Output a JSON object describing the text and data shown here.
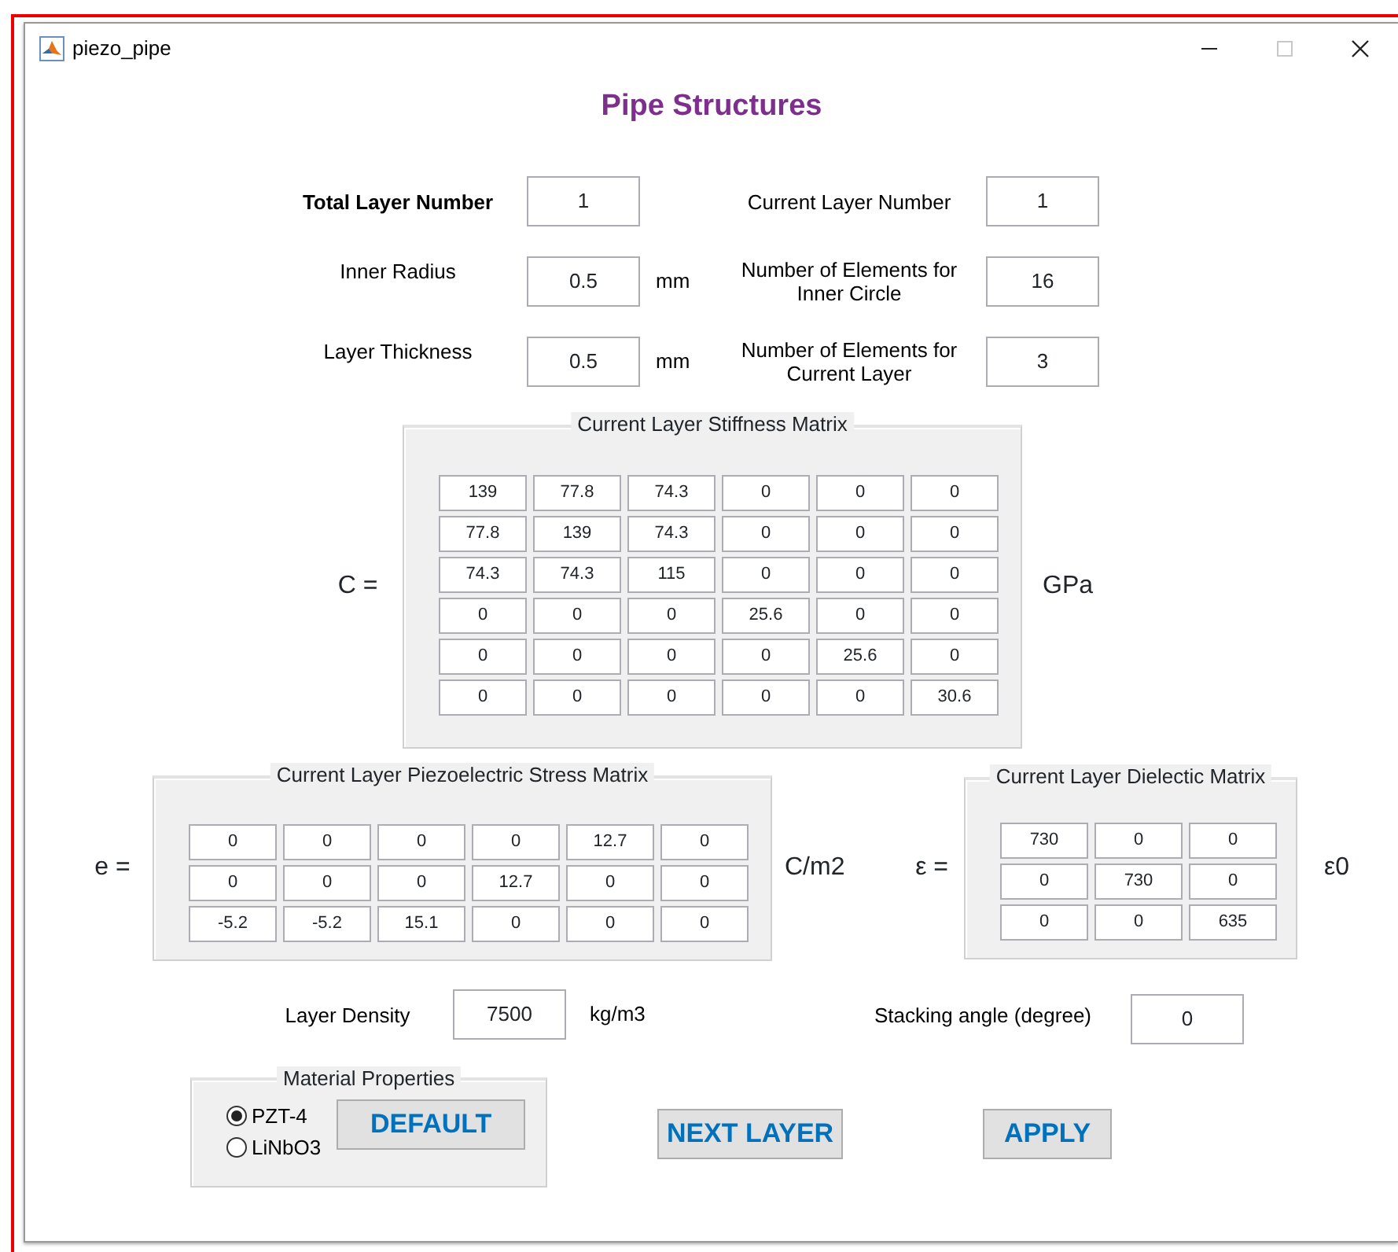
{
  "window": {
    "title": "piezo_pipe",
    "maximize_disabled": true
  },
  "heading": "Pipe Structures",
  "geometry_rows": [
    {
      "left": {
        "label": "Total Layer Number",
        "bold": true,
        "value": "1"
      },
      "right": {
        "label": "Current Layer Number",
        "value": "1"
      }
    },
    {
      "left": {
        "label": "Inner Radius",
        "bold": false,
        "value": "0.5",
        "unit": "mm"
      },
      "right": {
        "label": "Number of Elements for Inner Circle",
        "value": "16"
      }
    },
    {
      "left": {
        "label": "Layer Thickness",
        "bold": false,
        "value": "0.5",
        "unit": "mm"
      },
      "right": {
        "label": "Number of Elements for Current Layer",
        "value": "3"
      }
    }
  ],
  "stiffness": {
    "symbol": "C =",
    "title": "Current Layer Stiffness Matrix",
    "unit": "GPa",
    "rows": [
      [
        "139",
        "77.8",
        "74.3",
        "0",
        "0",
        "0"
      ],
      [
        "77.8",
        "139",
        "74.3",
        "0",
        "0",
        "0"
      ],
      [
        "74.3",
        "74.3",
        "115",
        "0",
        "0",
        "0"
      ],
      [
        "0",
        "0",
        "0",
        "25.6",
        "0",
        "0"
      ],
      [
        "0",
        "0",
        "0",
        "0",
        "25.6",
        "0"
      ],
      [
        "0",
        "0",
        "0",
        "0",
        "0",
        "30.6"
      ]
    ]
  },
  "piezo": {
    "symbol": "e =",
    "title": "Current Layer Piezoelectric Stress Matrix",
    "unit": "C/m2",
    "rows": [
      [
        "0",
        "0",
        "0",
        "0",
        "12.7",
        "0"
      ],
      [
        "0",
        "0",
        "0",
        "12.7",
        "0",
        "0"
      ],
      [
        "-5.2",
        "-5.2",
        "15.1",
        "0",
        "0",
        "0"
      ]
    ]
  },
  "dielectric": {
    "symbol": "ε =",
    "title": "Current Layer Dielectic Matrix",
    "unit": "ε0",
    "rows": [
      [
        "730",
        "0",
        "0"
      ],
      [
        "0",
        "730",
        "0"
      ],
      [
        "0",
        "0",
        "635"
      ]
    ]
  },
  "density": {
    "label": "Layer Density",
    "value": "7500",
    "unit": "kg/m3"
  },
  "stacking": {
    "label": "Stacking angle (degree)",
    "value": "0"
  },
  "material": {
    "title": "Material Properties",
    "options": [
      {
        "label": "PZT-4",
        "selected": true
      },
      {
        "label": "LiNbO3",
        "selected": false
      }
    ],
    "button": "DEFAULT"
  },
  "buttons": [
    "NEXT LAYER",
    "APPLY"
  ]
}
